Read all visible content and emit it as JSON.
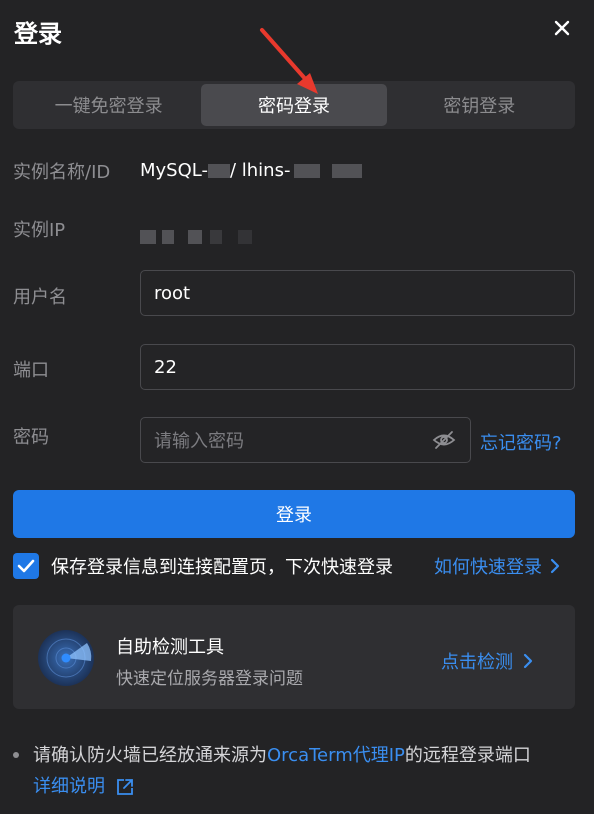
{
  "dialog": {
    "title": "登录"
  },
  "tabs": [
    {
      "label": "一键免密登录",
      "active": false
    },
    {
      "label": "密码登录",
      "active": true
    },
    {
      "label": "密钥登录",
      "active": false
    }
  ],
  "instance": {
    "name_label": "实例名称/ID",
    "name_value_prefix": "MySQL-",
    "name_value_middle": "/ lhins-",
    "ip_label": "实例IP"
  },
  "form": {
    "username_label": "用户名",
    "username_value": "root",
    "port_label": "端口",
    "port_value": "22",
    "password_label": "密码",
    "password_placeholder": "请输入密码",
    "forgot_label": "忘记密码?"
  },
  "login_button": "登录",
  "save_option": {
    "label": "保存登录信息到连接配置页，下次快速登录",
    "checked": true,
    "link_label": "如何快速登录"
  },
  "tool": {
    "title": "自助检测工具",
    "subtitle": "快速定位服务器登录问题",
    "link_label": "点击检测"
  },
  "note": {
    "text_before": "请确认防火墙已经放通来源为",
    "link_text": "OrcaTerm代理IP",
    "text_after": "的远程登录端口",
    "detail_link": "详细说明"
  },
  "icons": {
    "close": "close-icon",
    "eye": "eye-off-icon",
    "check": "check-icon",
    "chevron": "chevron-right-icon",
    "external": "external-link-icon",
    "radar": "radar-icon"
  },
  "colors": {
    "background": "#232325",
    "accent": "#1f78e6",
    "link": "#3a8ef0",
    "annotation_arrow": "#e8392d"
  }
}
